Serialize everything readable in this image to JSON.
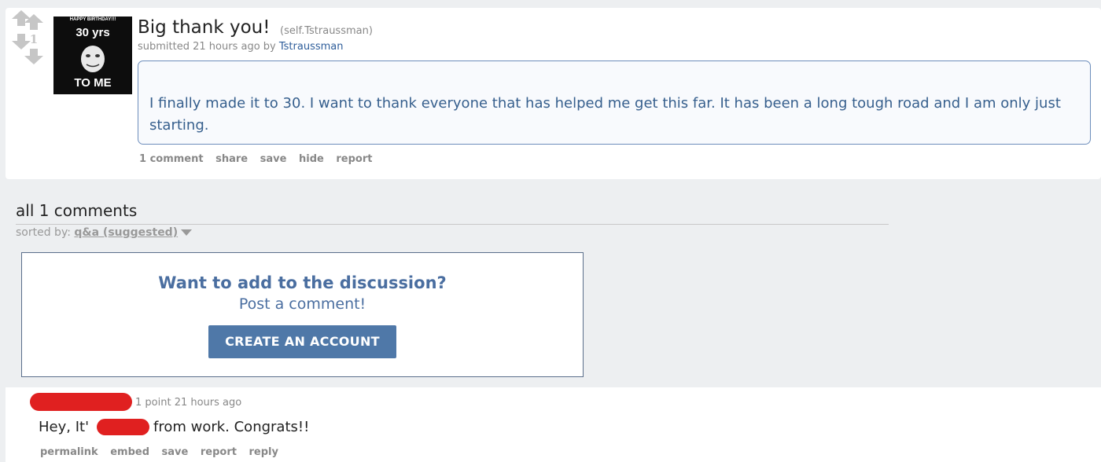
{
  "post": {
    "score": "1",
    "title": "Big thank you!",
    "domain": "(self.Tstraussman)",
    "tagline_prefix": "submitted 21 hours ago by ",
    "author": "Tstraussman",
    "selftext": "I finally made it to 30. I want to thank everyone that has helped me get this far. It has been a long tough road and I am only just starting.",
    "thumbnail": {
      "line1": "HAPPY BIRTHDAY!!!",
      "line2": "30 yrs",
      "line3": "TO ME"
    },
    "buttons": [
      "1 comment",
      "share",
      "save",
      "hide",
      "report"
    ]
  },
  "comments_section": {
    "heading": "all 1 comments",
    "sorted_by_label": "sorted by: ",
    "sort_value": "q&a (suggested)"
  },
  "cta": {
    "title": "Want to add to the discussion?",
    "subtitle": "Post a comment!",
    "button": "CREATE AN ACCOUNT"
  },
  "comment": {
    "meta": "1 point 21 hours ago",
    "body_start": "Hey, It'",
    "body_end": "from work. Congrats!!",
    "buttons": [
      "permalink",
      "embed",
      "save",
      "report",
      "reply"
    ]
  },
  "colors": {
    "background": "#edeff1",
    "link_blue": "#2e5d9a",
    "cta_button": "#4f78a8",
    "redaction": "#e02020"
  }
}
